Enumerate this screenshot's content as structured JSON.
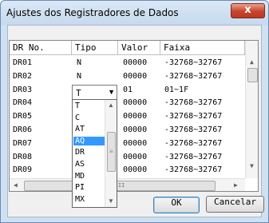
{
  "window": {
    "title": "Ajustes dos Registradores de Dados",
    "close_glyph": "x"
  },
  "table": {
    "columns": [
      "DR No.",
      "Tipo",
      "Valor",
      "Faixa"
    ],
    "rows": [
      {
        "dr": "DR01",
        "tipo": "N",
        "valor": "00000",
        "faixa": "-32768~32767"
      },
      {
        "dr": "DR02",
        "tipo": "N",
        "valor": "00000",
        "faixa": "-32768~32767"
      },
      {
        "dr": "DR03",
        "tipo": "T",
        "valor": "01",
        "faixa": "01~1F"
      },
      {
        "dr": "DR04",
        "tipo": "",
        "valor": "00000",
        "faixa": "-32768~32767"
      },
      {
        "dr": "DR05",
        "tipo": "",
        "valor": "00000",
        "faixa": "-32768~32767"
      },
      {
        "dr": "DR06",
        "tipo": "",
        "valor": "00000",
        "faixa": "-32768~32767"
      },
      {
        "dr": "DR07",
        "tipo": "",
        "valor": "00000",
        "faixa": "-32768~32767"
      },
      {
        "dr": "DR08",
        "tipo": "",
        "valor": "00000",
        "faixa": "-32768~32767"
      },
      {
        "dr": "DR09",
        "tipo": "",
        "valor": "00000",
        "faixa": "-32768~32767"
      }
    ],
    "hscroll_center_glyph": "III"
  },
  "tipo_dropdown": {
    "selected": "T",
    "options": [
      "T",
      "C",
      "AT",
      "AQ",
      "DR",
      "AS",
      "MD",
      "PI",
      "MX"
    ],
    "highlighted": "AQ",
    "thumb_grip": "≡"
  },
  "buttons": {
    "ok": "OK",
    "cancel": "Cancelar"
  },
  "colors": {
    "selection": "#3399ff",
    "close_button": "#c7442c"
  }
}
